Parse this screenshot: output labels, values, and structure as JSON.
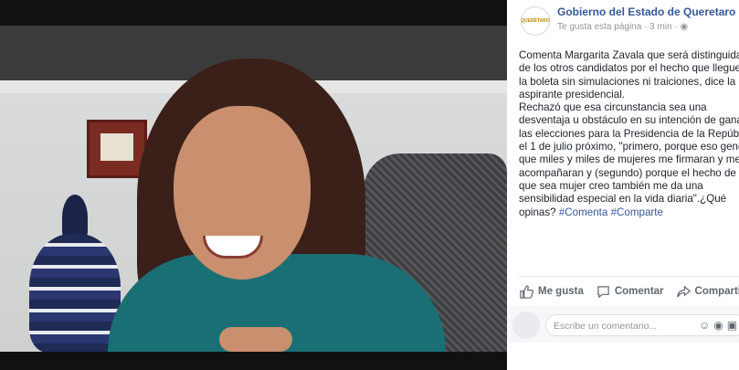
{
  "post": {
    "page_name": "Gobierno del Estado de Queretaro",
    "meta": "Te gusta esta página · 3 min · ",
    "avatar_text": "QUERÉTARO",
    "paragraph1": "Comenta Margarita Zavala que será distinguida de los otros candidatos por el hecho que llegue a la boleta sin simulaciones ni traiciones, dice la aspirante presidencial.",
    "paragraph2": "Rechazó que esa circunstancia sea una desventaja u obstáculo en su intención de ganar las elecciones para la Presidencia de la República el 1 de julio próximo, \"primero, porque eso generó que miles y miles de mujeres me firmaran y me acompañaran y (segundo) porque el hecho de que sea mujer creo también me da una sensibilidad especial en la vida diaria\".¿Qué opinas? ",
    "hashtag1": "#Comenta",
    "hashtag2": "#Comparte"
  },
  "actions": {
    "like": "Me gusta",
    "comment": "Comentar",
    "share": "Compartir"
  },
  "comment_box": {
    "placeholder": "Escribe un comentario..."
  },
  "colors": {
    "link": "#365899",
    "text": "#1d2129",
    "muted": "#90949c"
  }
}
